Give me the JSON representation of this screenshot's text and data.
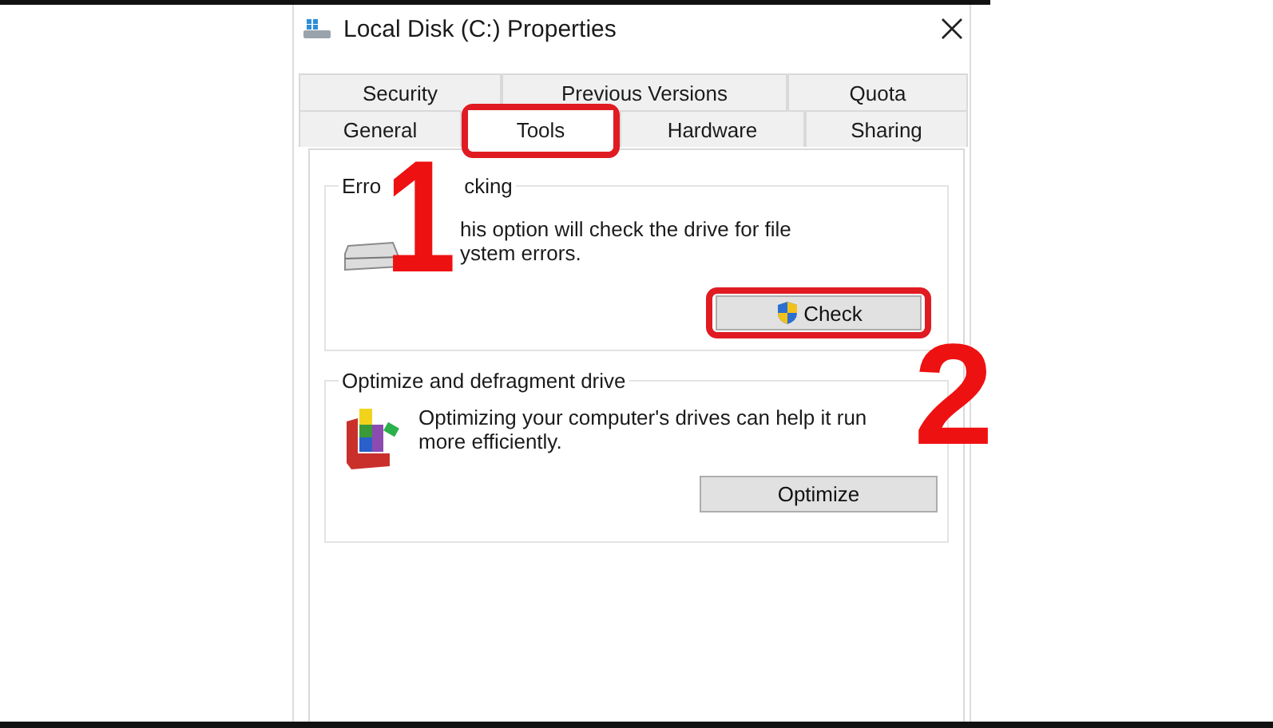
{
  "window": {
    "title": "Local Disk (C:) Properties"
  },
  "tab_rows": [
    {
      "tabs": [
        {
          "label": "Security",
          "selected": false
        },
        {
          "label": "Previous Versions",
          "selected": false
        },
        {
          "label": "Quota",
          "selected": false
        }
      ]
    },
    {
      "tabs": [
        {
          "label": "General",
          "selected": false
        },
        {
          "label": "Tools",
          "selected": true
        },
        {
          "label": "Hardware",
          "selected": false
        },
        {
          "label": "Sharing",
          "selected": false
        }
      ]
    }
  ],
  "error_checking": {
    "label_parts": [
      "Erro",
      "cking"
    ],
    "description_lines": [
      "his option will check the drive for file",
      "ystem errors."
    ],
    "button": "Check"
  },
  "optimize": {
    "label": "Optimize and defragment drive",
    "description": "Optimizing your computer's drives can help it run more efficiently.",
    "button": "Optimize"
  },
  "annotations": [
    {
      "text": "1"
    },
    {
      "text": "2"
    }
  ]
}
